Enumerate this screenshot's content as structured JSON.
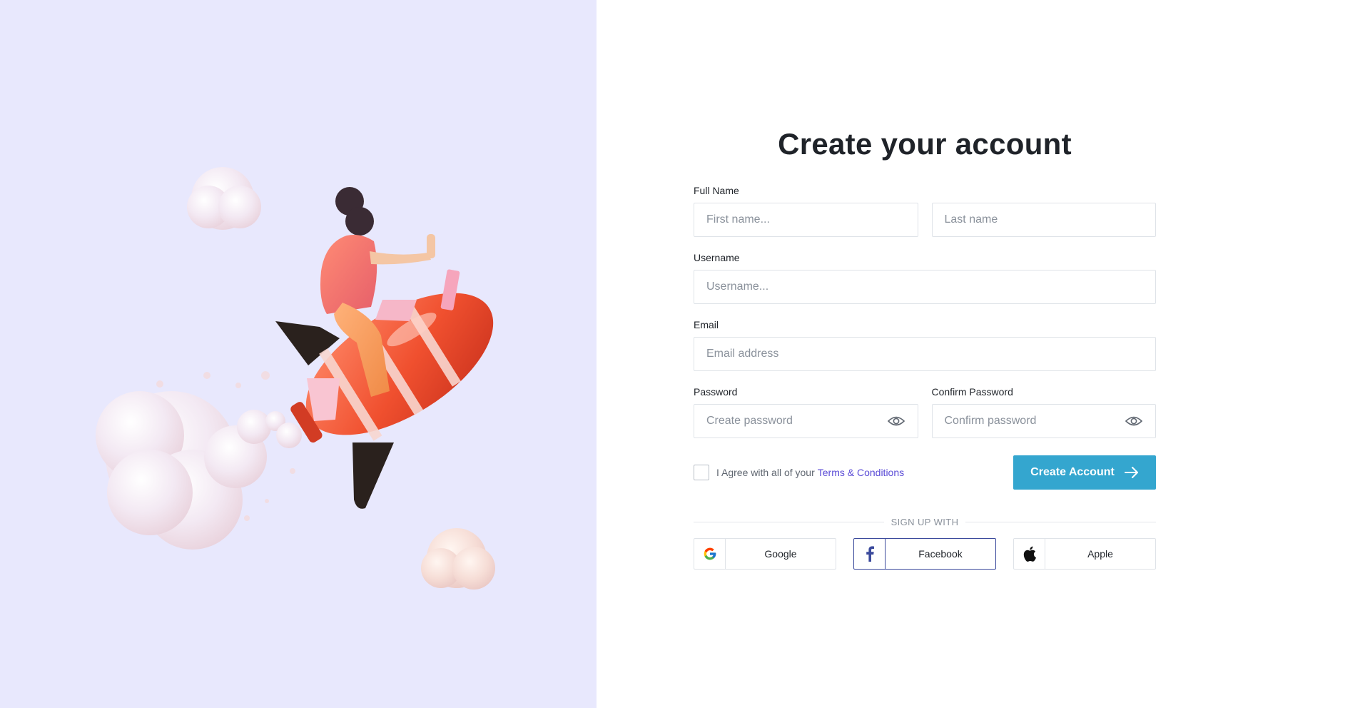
{
  "form": {
    "title": "Create your account",
    "full_name": {
      "label": "Full Name",
      "first_placeholder": "First name...",
      "last_placeholder": "Last name"
    },
    "username": {
      "label": "Username",
      "placeholder": "Username..."
    },
    "email": {
      "label": "Email",
      "placeholder": "Email address"
    },
    "password": {
      "label": "Password",
      "placeholder": "Create password"
    },
    "confirm_password": {
      "label": "Confirm Password",
      "placeholder": "Confirm password"
    },
    "agree": {
      "text": "I Agree with all of your",
      "link": "Terms & Conditions"
    },
    "submit_label": "Create Account"
  },
  "signup": {
    "divider": "SIGN UP WITH",
    "providers": [
      {
        "label": "Google",
        "icon": "google-icon"
      },
      {
        "label": "Facebook",
        "icon": "facebook-icon"
      },
      {
        "label": "Apple",
        "icon": "apple-icon"
      }
    ]
  },
  "colors": {
    "left_bg": "#e8e8fd",
    "primary": "#34a6cf",
    "link": "#5a4bd6",
    "facebook": "#3b4a9c"
  }
}
